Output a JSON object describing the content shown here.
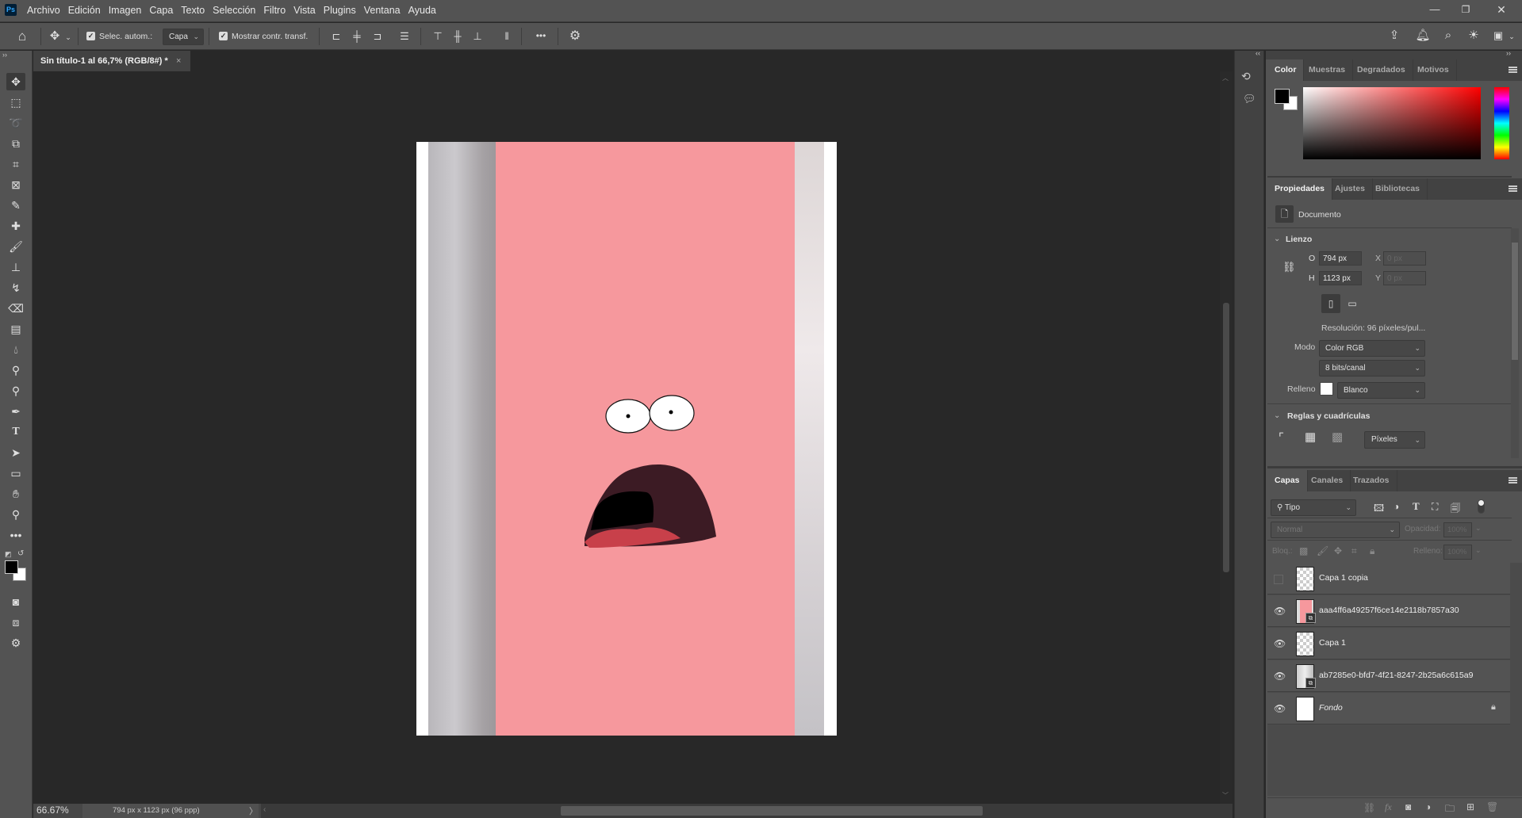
{
  "app": {
    "logo": "Ps",
    "menu": [
      "Archivo",
      "Edición",
      "Imagen",
      "Capa",
      "Texto",
      "Selección",
      "Filtro",
      "Vista",
      "Plugins",
      "Ventana",
      "Ayuda"
    ]
  },
  "options": {
    "auto_select_label": "Selec. autom.:",
    "auto_select_target": "Capa",
    "show_transform_label": "Mostrar contr. transf.",
    "more": "•••"
  },
  "document": {
    "tab_title": "Sin título-1 al 66,7% (RGB/8#) *",
    "zoom": "66.67%",
    "info": "794 px x 1123 px (96 ppp)"
  },
  "colors": {
    "accent_pink": "#f6989d",
    "mouth_dark": "#3c1b24",
    "tongue": "#c8404a",
    "panel": "#535353",
    "bg": "#282828"
  },
  "color_panel": {
    "tabs": [
      "Color",
      "Muestras",
      "Degradados",
      "Motivos"
    ]
  },
  "properties": {
    "tabs": [
      "Propiedades",
      "Ajustes",
      "Bibliotecas"
    ],
    "doc_label": "Documento",
    "canvas_section": "Lienzo",
    "w_label": "O",
    "w_value": "794 px",
    "h_label": "H",
    "h_value": "1123 px",
    "x_label": "X",
    "x_value": "0 px",
    "y_label": "Y",
    "y_value": "0 px",
    "resolution": "Resolución:  96  píxeles/pul...",
    "mode_label": "Modo",
    "mode_value": "Color RGB",
    "depth_value": "8 bits/canal",
    "fill_label": "Relleno",
    "fill_value": "Blanco",
    "rulers_section": "Reglas y cuadrículas",
    "units_value": "Píxeles"
  },
  "layers_panel": {
    "tabs": [
      "Capas",
      "Canales",
      "Trazados"
    ],
    "filter": "Tipo",
    "blend": "Normal",
    "opacity_label": "Opacidad:",
    "opacity": "100%",
    "lock_label": "Bloq.:",
    "fill_label": "Relleno:",
    "fill": "100%",
    "layers": [
      {
        "name": "Capa 1 copia",
        "visible": false
      },
      {
        "name": "aaa4ff6a49257f6ce14e2118b7857a30",
        "visible": true
      },
      {
        "name": "Capa 1",
        "visible": true
      },
      {
        "name": "ab7285e0-bfd7-4f21-8247-2b25a6c615a9",
        "visible": true
      },
      {
        "name": "Fondo",
        "visible": true,
        "locked": true
      }
    ]
  }
}
